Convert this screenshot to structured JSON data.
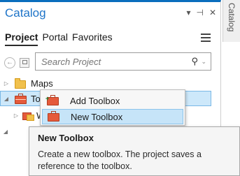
{
  "pane": {
    "title": "Catalog",
    "controls": {
      "dropdown": "▾",
      "pin": "⊣",
      "close": "✕"
    }
  },
  "tabs": [
    {
      "label": "Project",
      "active": true
    },
    {
      "label": "Portal",
      "active": false
    },
    {
      "label": "Favorites",
      "active": false
    }
  ],
  "search": {
    "placeholder": "Search Project",
    "value": ""
  },
  "tree": [
    {
      "label": "Maps",
      "expander": "▷",
      "icon": "folder-icon"
    },
    {
      "label": "Toolbo",
      "expander": "◢",
      "icon": "toolbox-icon",
      "selected": true
    },
    {
      "label": "Wa",
      "expander": "▷",
      "icon": "toolbox-workspace-icon"
    },
    {
      "label": "",
      "expander": "◢",
      "icon": ""
    }
  ],
  "context_menu": {
    "items": [
      {
        "label": "Add Toolbox",
        "icon": "add-toolbox-icon",
        "highlighted": false
      },
      {
        "label": "New Toolbox",
        "icon": "new-toolbox-icon",
        "highlighted": true
      }
    ]
  },
  "tooltip": {
    "title": "New Toolbox",
    "description": "Create a new toolbox. The project saves a reference to the toolbox."
  },
  "side_tab": {
    "label": "Catalog"
  },
  "colors": {
    "accent": "#1e74c8",
    "selection": "#cde8fa",
    "toolbox": "#e55a3b",
    "folder": "#f1c14d"
  }
}
